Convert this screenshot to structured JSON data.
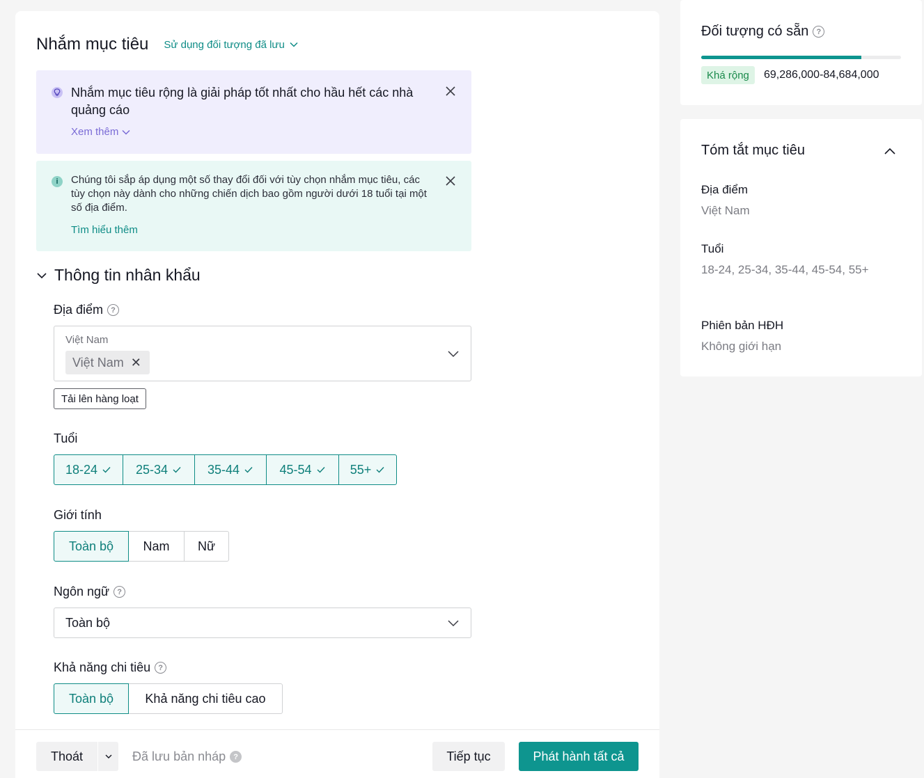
{
  "header": {
    "title": "Nhắm mục tiêu",
    "saved_audience_link": "Sử dụng đối tượng đã lưu"
  },
  "tip_banner": {
    "text": "Nhắm mục tiêu rộng là giải pháp tốt nhất cho hầu hết các nhà quảng cáo",
    "link": "Xem thêm"
  },
  "info_banner": {
    "text": "Chúng tôi sắp áp dụng một số thay đổi đối với tùy chọn nhắm mục tiêu, các tùy chọn này dành cho những chiến dịch bao gồm người dưới 18 tuổi tại một số địa điểm.",
    "link": "Tìm hiểu thêm"
  },
  "demographics": {
    "section_title": "Thông tin nhân khẩu",
    "location": {
      "label": "Địa điểm",
      "field_label": "Việt Nam",
      "chip": "Việt Nam",
      "bulk_upload": "Tải lên hàng loạt"
    },
    "age": {
      "label": "Tuổi",
      "options": [
        "18-24",
        "25-34",
        "35-44",
        "45-54",
        "55+"
      ]
    },
    "gender": {
      "label": "Giới tính",
      "options": [
        "Toàn bộ",
        "Nam",
        "Nữ"
      ],
      "selected": "Toàn bộ"
    },
    "language": {
      "label": "Ngôn ngữ",
      "value": "Toàn bộ"
    },
    "spending": {
      "label": "Khả năng chi tiêu",
      "options": [
        "Toàn bộ",
        "Khả năng chi tiêu cao"
      ],
      "selected": "Toàn bộ"
    }
  },
  "footer": {
    "exit": "Thoát",
    "draft_status": "Đã lưu bản nháp",
    "continue": "Tiếp tục",
    "publish": "Phát hành tất cả"
  },
  "audience": {
    "title": "Đối tượng có sẵn",
    "fill_fraction": 0.8,
    "badge": "Khá rộng",
    "range": "69,286,000-84,684,000",
    "accent_color": "#0e958f"
  },
  "summary": {
    "title": "Tóm tắt mục tiêu",
    "location_label": "Địa điểm",
    "location_value": "Việt Nam",
    "age_label": "Tuổi",
    "age_value": "18-24, 25-34, 35-44, 45-54, 55+",
    "os_label": "Phiên bản HĐH",
    "os_value": "Không giới hạn"
  }
}
